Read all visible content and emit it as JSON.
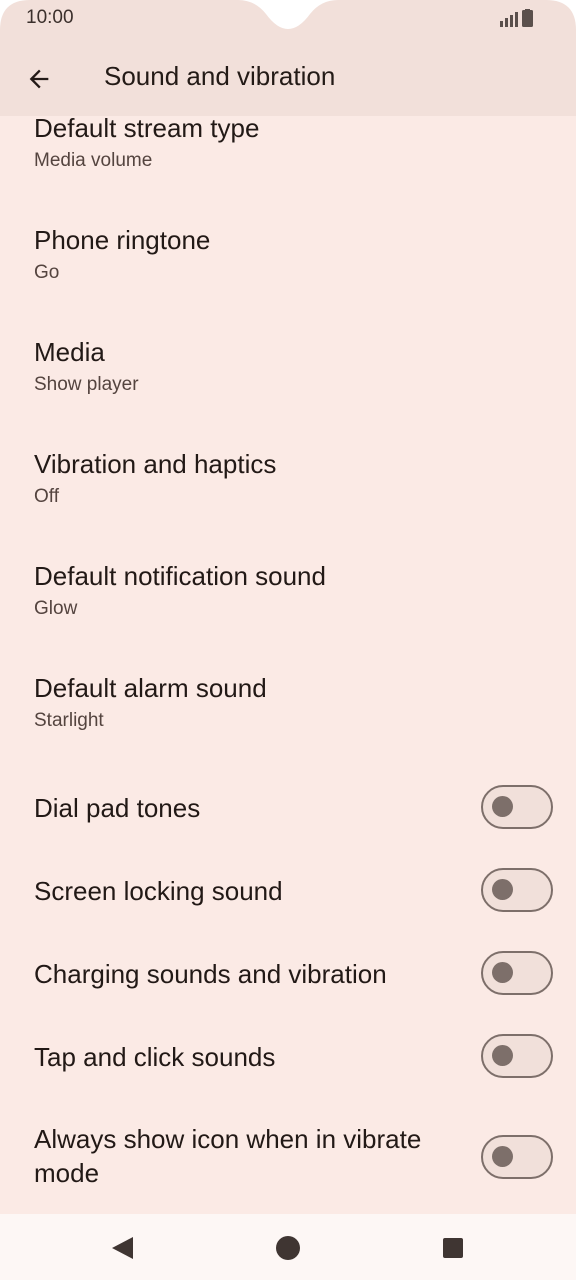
{
  "status_bar": {
    "time": "10:00",
    "signal_icon": "signal-icon",
    "battery_icon": "battery-icon"
  },
  "header": {
    "title": "Sound and vibration",
    "back_icon": "back-arrow-icon"
  },
  "preferences": [
    {
      "title": "Default stream type",
      "summary": "Media volume"
    },
    {
      "title": "Phone ringtone",
      "summary": "Go"
    },
    {
      "title": "Media",
      "summary": "Show player"
    },
    {
      "title": "Vibration and haptics",
      "summary": "Off"
    },
    {
      "title": "Default notification sound",
      "summary": "Glow"
    },
    {
      "title": "Default alarm sound",
      "summary": "Starlight"
    }
  ],
  "toggles": [
    {
      "title": "Dial pad tones",
      "on": false
    },
    {
      "title": "Screen locking sound",
      "on": false
    },
    {
      "title": "Charging sounds and vibration",
      "on": false
    },
    {
      "title": "Tap and click sounds",
      "on": false
    },
    {
      "title": "Always show icon when in vibrate mode",
      "on": false
    }
  ],
  "nav_bar": {
    "back_icon": "nav-back-icon",
    "home_icon": "nav-home-icon",
    "recents_icon": "nav-recents-icon"
  },
  "colors": {
    "background": "#fbeae5",
    "top_bar": "#f2e0da",
    "switch_outline": "#7d6f6a"
  }
}
